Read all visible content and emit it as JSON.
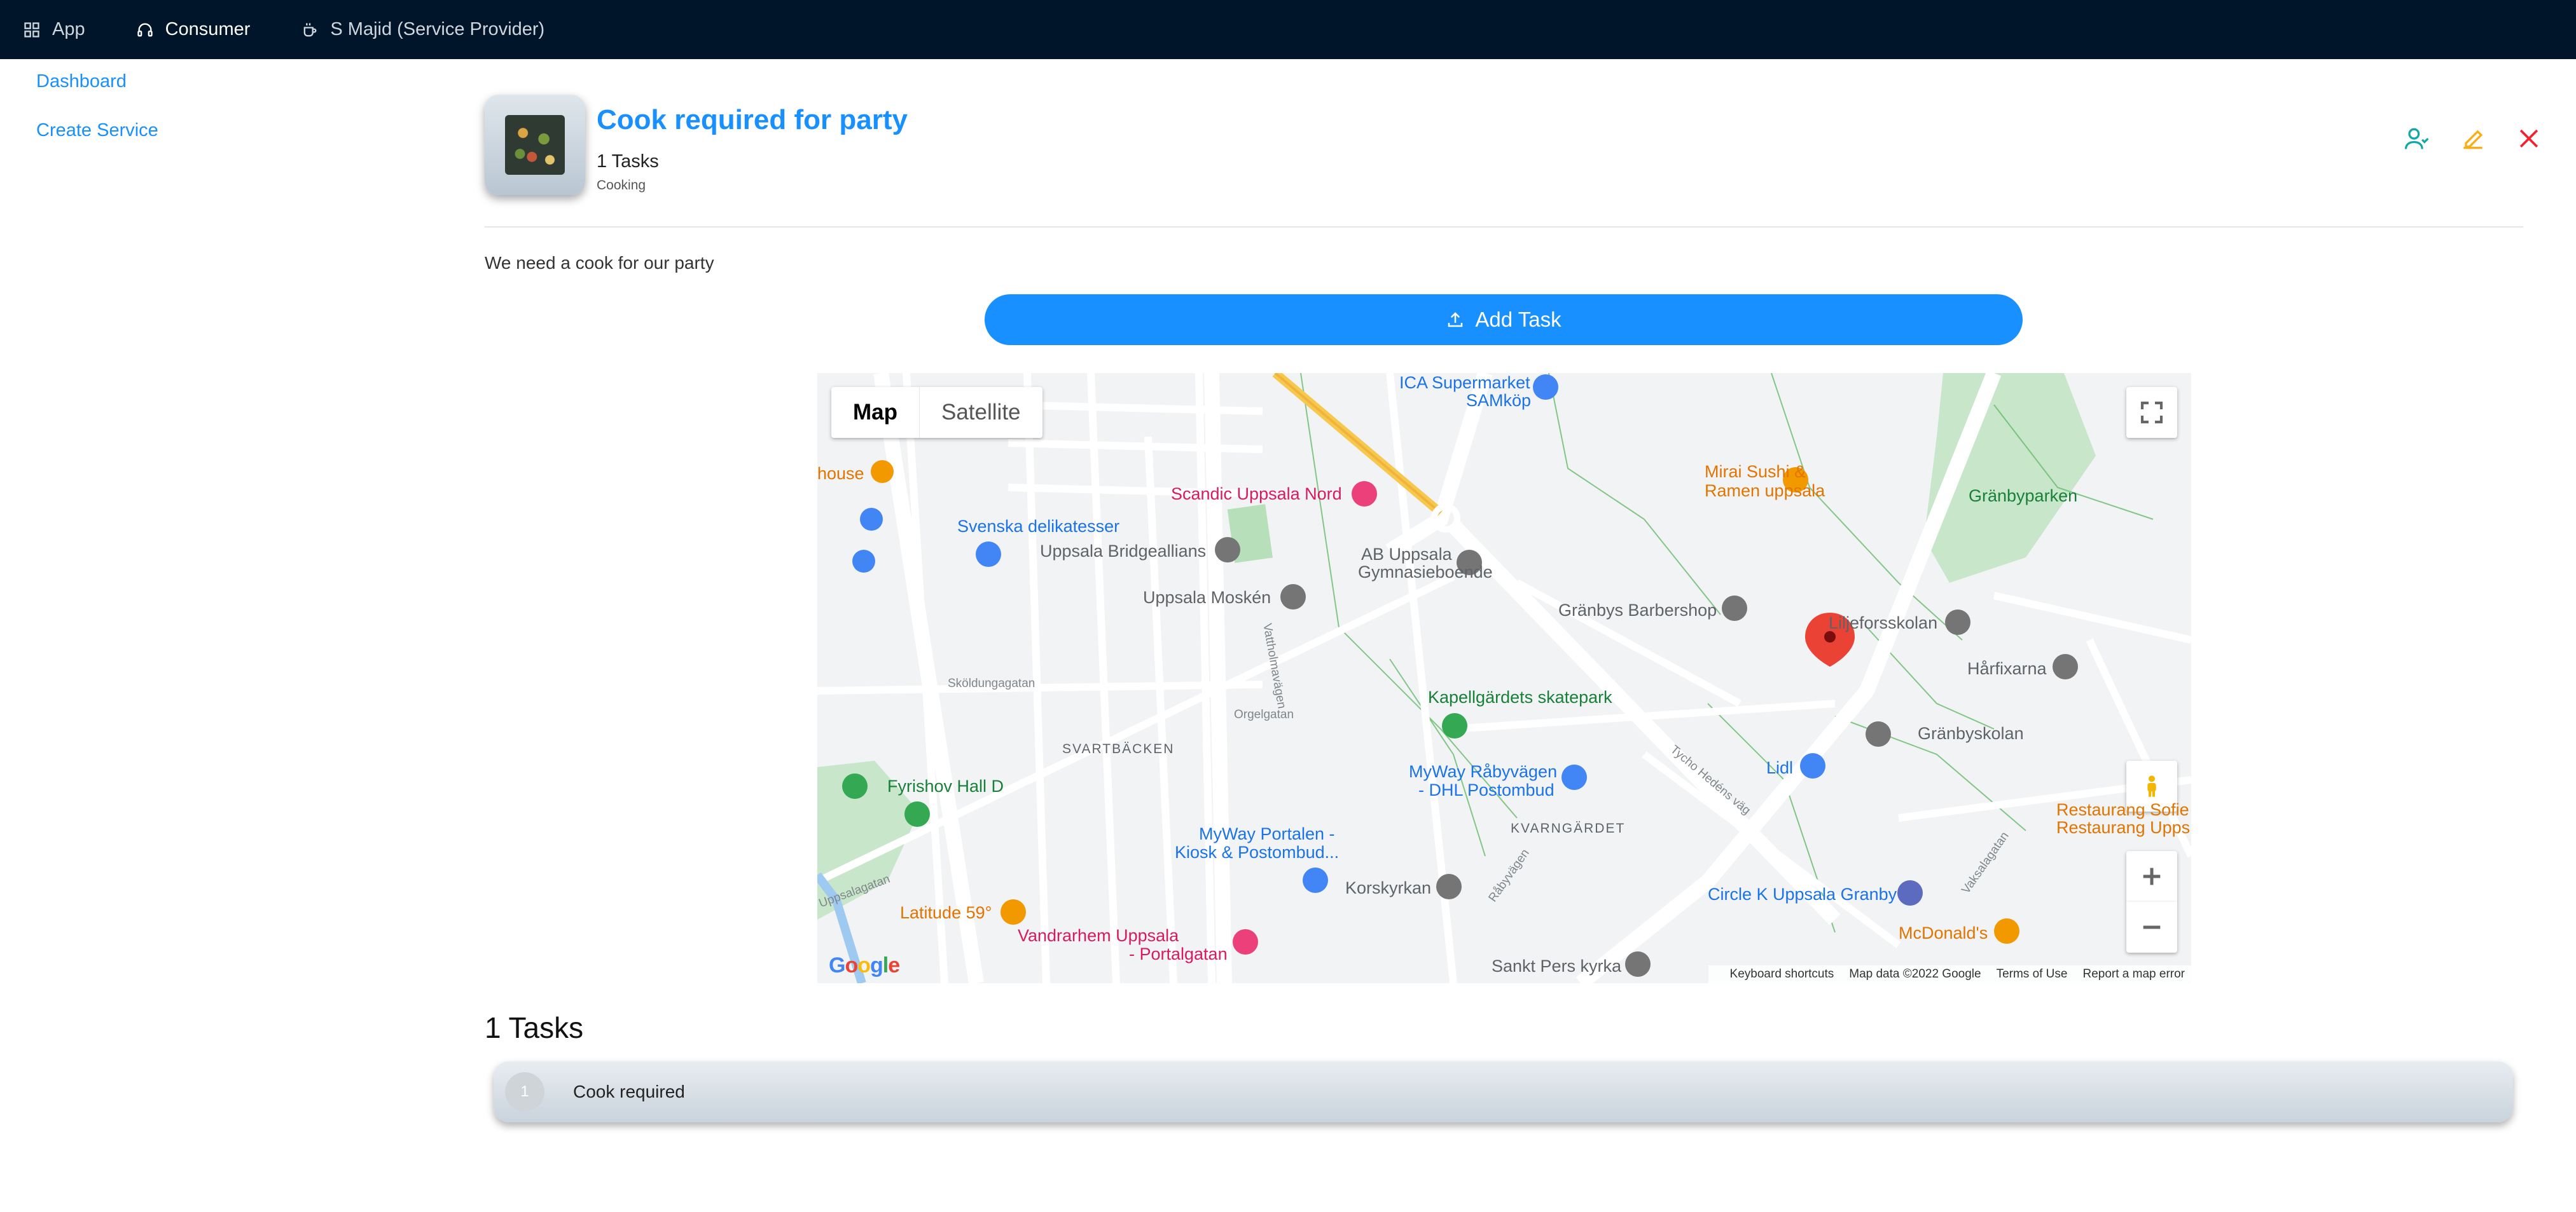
{
  "topbar": {
    "items": [
      {
        "label": "App",
        "icon": "app-grid-icon"
      },
      {
        "label": "Consumer",
        "icon": "headphones-icon"
      },
      {
        "label": "S Majid (Service Provider)",
        "icon": "coffee-cup-icon"
      }
    ]
  },
  "sidebar": {
    "items": [
      {
        "label": "Dashboard"
      },
      {
        "label": "Create Service"
      }
    ]
  },
  "service": {
    "title": "Cook required for party",
    "task_count": "1 Tasks",
    "category": "Cooking",
    "description": "We need a cook for our party",
    "add_task_label": "Add Task"
  },
  "actions": {
    "assign_icon": "user-assign-icon",
    "edit_icon": "edit-icon",
    "close_icon": "close-icon",
    "colors": {
      "assign": "#13a8a8",
      "edit": "#faad14",
      "close": "#f5222d"
    }
  },
  "map": {
    "type_map": "Map",
    "type_satellite": "Satellite",
    "labels": {
      "ica": "ICA Supermarket",
      "ica2": "SAMköp",
      "scandic": "Scandic Uppsala Nord",
      "mirai1": "Mirai Sushi &",
      "mirai2": "Ramen uppsala",
      "granbyparken": "Gränbyparken",
      "svenska": "Svenska delikatesser",
      "bridge": "Uppsala Bridgeallians",
      "ab1": "AB Uppsala",
      "ab2": "Gymnasieboende",
      "moske": "Uppsala Moskén",
      "barber": "Gränbys Barbershop",
      "liljefors": "Liljeforsskolan",
      "harfixarna": "Hårfixarna",
      "kapell": "Kapellgärdets skatepark",
      "granbyskolan": "Gränbyskolan",
      "myway1a": "MyWay Råbyvägen",
      "myway1b": "- DHL Postombud",
      "lidl": "Lidl",
      "fyrishov": "Fyrishov Hall D",
      "svartbacken": "SVARTBÄCKEN",
      "kvarngardet": "KVARNGÄRDET",
      "myway2a": "MyWay Portalen -",
      "myway2b": "Kiosk & Postombud...",
      "korskyrkan": "Korskyrkan",
      "circlek": "Circle K Uppsala Granby",
      "latitude": "Latitude 59°",
      "mcdonalds": "McDonald's",
      "vandrarhem1": "Vandrarhem Uppsala",
      "vandrarhem2": "- Portalgatan",
      "sanktpers": "Sankt Pers kyrka",
      "restaurang1": "Restaurang Sofie",
      "restaurang2": "Restaurang Upps",
      "house": "house",
      "skoldungagatan": "Sköldungagatan",
      "orgelgatan": "Orgelgatan",
      "rabyvagen": "Råbyvägen",
      "tycho": "Tycho Hedéns väg",
      "vaksalagatan": "Vaksalagatan",
      "vattholma": "Vattholmavägen",
      "uppsalagatan": "Uppsalagatan"
    },
    "footer": {
      "shortcuts": "Keyboard shortcuts",
      "data": "Map data ©2022 Google",
      "terms": "Terms of Use",
      "report": "Report a map error"
    },
    "logo": "Google"
  },
  "tasks": {
    "heading": "1 Tasks",
    "items": [
      {
        "number": "1",
        "name": "Cook required"
      }
    ]
  }
}
